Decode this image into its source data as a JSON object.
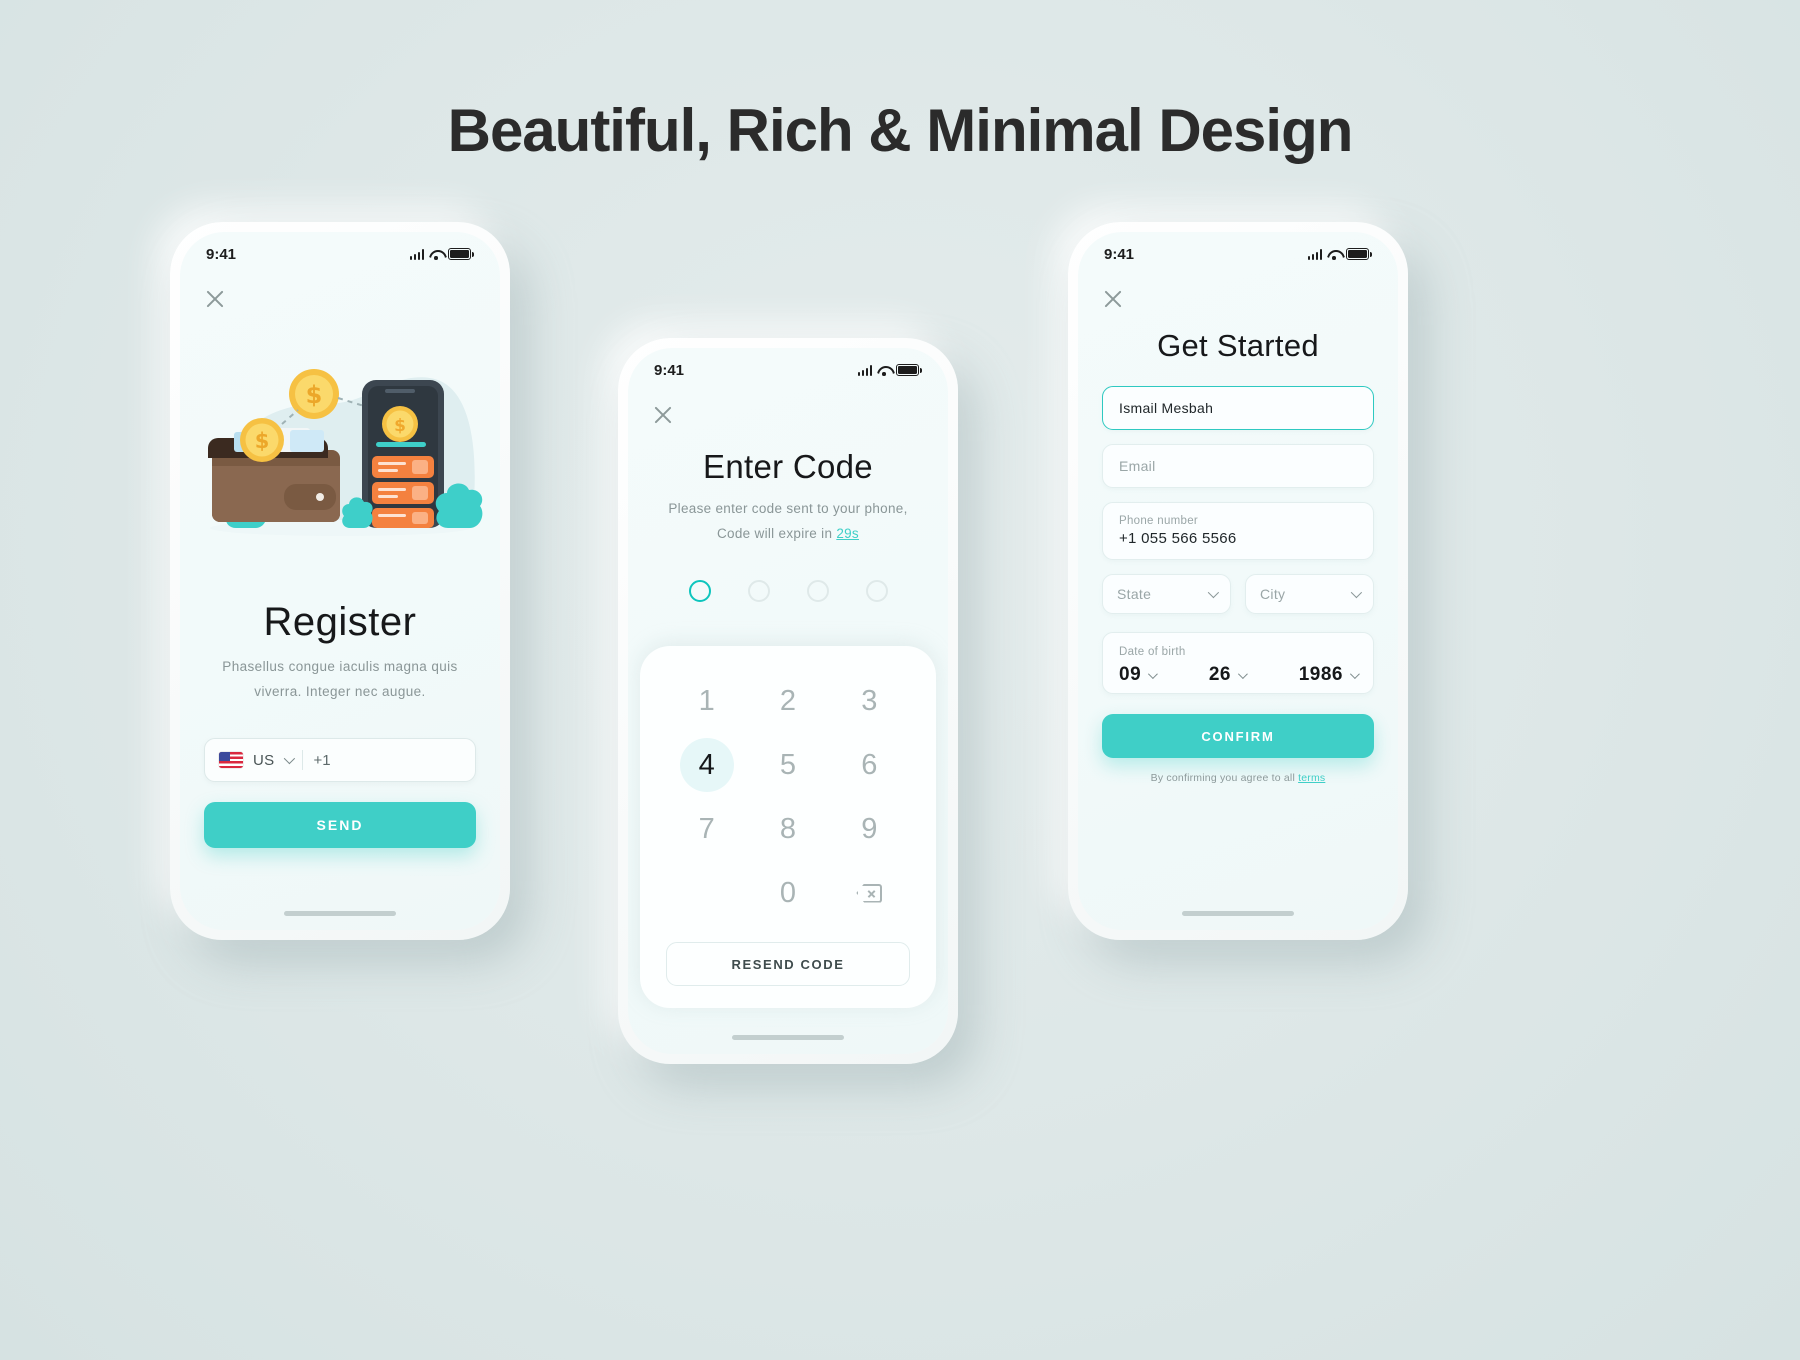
{
  "header": {
    "title": "Beautiful, Rich & Minimal Design"
  },
  "theme": {
    "accent": "#3fcfc7",
    "accent_dark": "#0dc5bd",
    "background": "#dde7e7",
    "text_dark": "#17181a",
    "text_muted": "#8a9697"
  },
  "screen1": {
    "status": {
      "time": "9:41",
      "signal_icon": "cellular-bars-icon",
      "wifi_icon": "wifi-icon",
      "battery_icon": "battery-full-icon"
    },
    "close_icon": "close-icon",
    "illustration": "wallet-coins-phone-illustration",
    "title": "Register",
    "subtitle": "Phasellus congue iaculis magna quis viverra. Integer nec augue.",
    "phone_field": {
      "flag_icon": "us-flag-icon",
      "country": "US",
      "chevron_icon": "chevron-down-icon",
      "dial_code": "+1"
    },
    "send_label": "SEND"
  },
  "screen2": {
    "status": {
      "time": "9:41",
      "signal_icon": "cellular-bars-icon",
      "wifi_icon": "wifi-icon",
      "battery_icon": "battery-full-icon"
    },
    "close_icon": "close-icon",
    "title": "Enter Code",
    "subtitle_line1": "Please enter code sent to your phone,",
    "subtitle_line2_prefix": "Code will expire in ",
    "timer": "29s",
    "otp_count": 4,
    "otp_active_index": 0,
    "keys": [
      "1",
      "2",
      "3",
      "4",
      "5",
      "6",
      "7",
      "8",
      "9",
      "",
      "0",
      "delete"
    ],
    "pressed_key": "4",
    "delete_icon": "backspace-icon",
    "resend_label": "RESEND CODE"
  },
  "screen3": {
    "status": {
      "time": "9:41",
      "signal_icon": "cellular-bars-icon",
      "wifi_icon": "wifi-icon",
      "battery_icon": "battery-full-icon"
    },
    "close_icon": "close-icon",
    "title": "Get Started",
    "name_value": "Ismail Mesbah",
    "email_placeholder": "Email",
    "phone_label": "Phone number",
    "phone_value": "+1 055 566 5566",
    "state_placeholder": "State",
    "city_placeholder": "City",
    "dob_label": "Date of birth",
    "dob_day": "09",
    "dob_month": "26",
    "dob_year": "1986",
    "confirm_label": "CONFIRM",
    "terms_prefix": "By confirming you agree to all ",
    "terms_link": "terms"
  }
}
